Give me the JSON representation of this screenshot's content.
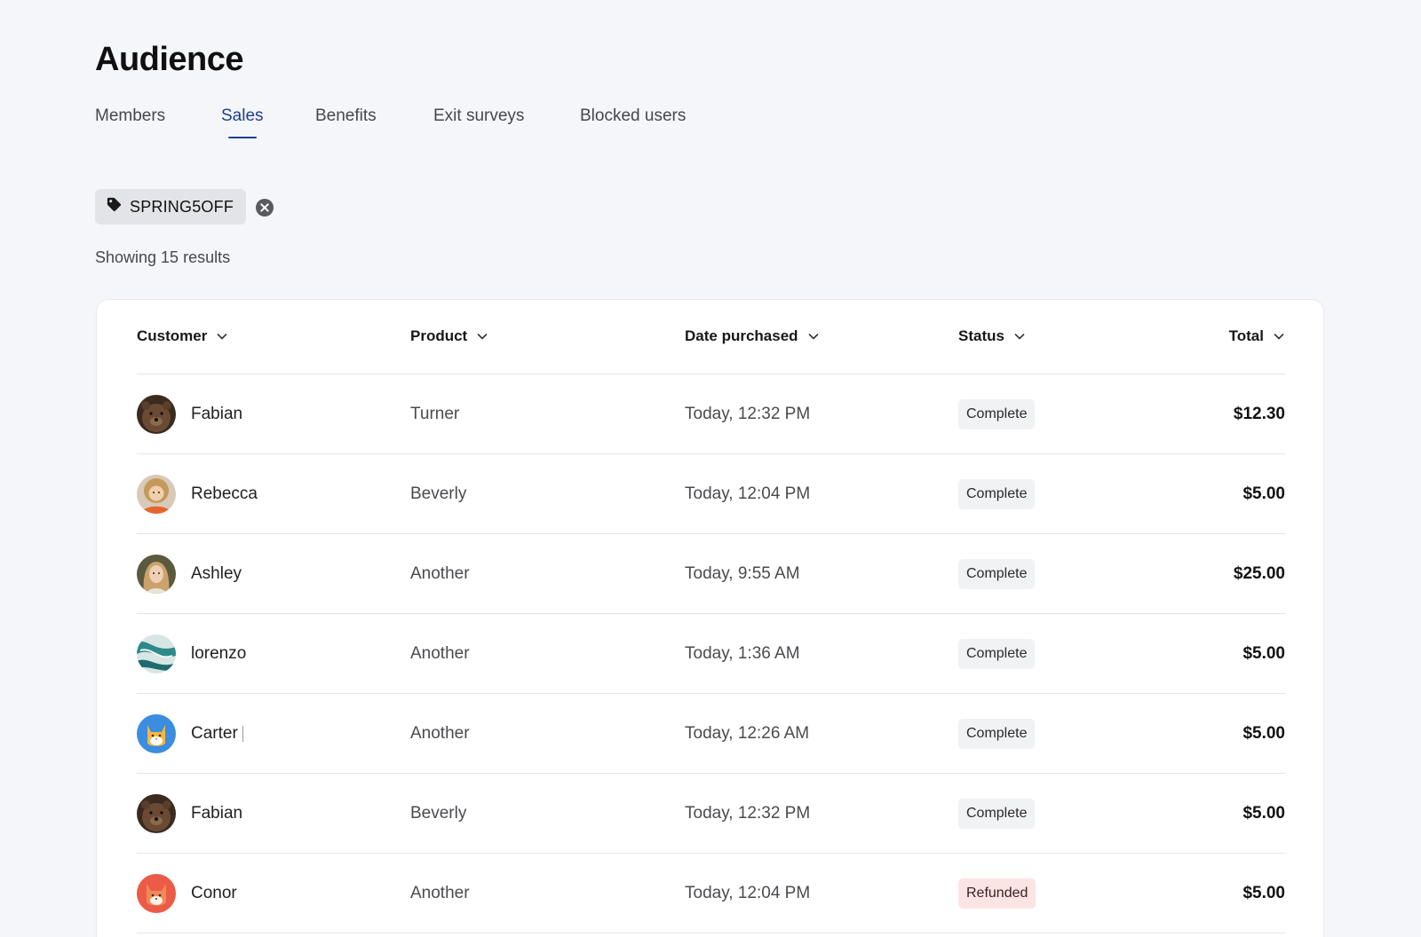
{
  "page": {
    "title": "Audience"
  },
  "tabs": [
    {
      "label": "Members",
      "active": false
    },
    {
      "label": "Sales",
      "active": true
    },
    {
      "label": "Benefits",
      "active": false
    },
    {
      "label": "Exit surveys",
      "active": false
    },
    {
      "label": "Blocked users",
      "active": false
    }
  ],
  "filter": {
    "label": "SPRING5OFF",
    "icon": "tag-icon",
    "remove_icon": "close-circle-icon"
  },
  "results": {
    "text": "Showing 15 results"
  },
  "table": {
    "columns": [
      {
        "label": "Customer",
        "icon": "chevron-down-icon"
      },
      {
        "label": "Product",
        "icon": "chevron-down-icon"
      },
      {
        "label": "Date purchased",
        "icon": "chevron-down-icon"
      },
      {
        "label": "Status",
        "icon": "chevron-down-icon"
      },
      {
        "label": "Total",
        "icon": "chevron-down-icon"
      }
    ],
    "rows": [
      {
        "customer": "Fabian",
        "avatar": "bear",
        "product": "Turner",
        "date": "Today, 12:32 PM",
        "status": "Complete",
        "total": "$12.30"
      },
      {
        "customer": "Rebecca",
        "avatar": "woman-curly",
        "product": "Beverly",
        "date": "Today, 12:04 PM",
        "status": "Complete",
        "total": "$5.00"
      },
      {
        "customer": "Ashley",
        "avatar": "woman-blonde",
        "product": "Another",
        "date": "Today, 9:55 AM",
        "status": "Complete",
        "total": "$25.00"
      },
      {
        "customer": "lorenzo",
        "avatar": "marble",
        "product": "Another",
        "date": "Today, 1:36 AM",
        "status": "Complete",
        "total": "$5.00"
      },
      {
        "customer": "Carter",
        "avatar": "cat-blue",
        "product": "Another",
        "date": "Today, 12:26 AM",
        "status": "Complete",
        "total": "$5.00"
      },
      {
        "customer": "Fabian",
        "avatar": "bear",
        "product": "Beverly",
        "date": "Today, 12:32 PM",
        "status": "Complete",
        "total": "$5.00"
      },
      {
        "customer": "Conor",
        "avatar": "fox-red",
        "product": "Another",
        "date": "Today, 12:04 PM",
        "status": "Refunded",
        "total": "$5.00"
      }
    ]
  },
  "colors": {
    "accent": "#1d3f8f",
    "background": "#f5f6fa",
    "badge_complete": "#f1f2f4",
    "badge_refunded": "#fde4e4"
  }
}
